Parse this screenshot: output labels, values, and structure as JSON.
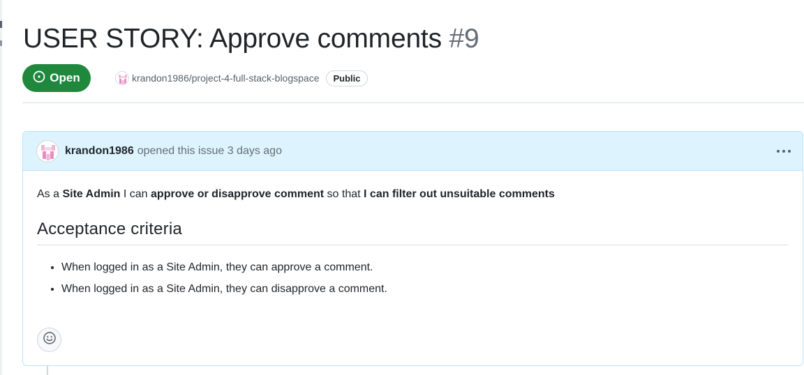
{
  "issue": {
    "title": "USER STORY: Approve comments",
    "number": "#9",
    "state": "Open",
    "repo": "krandon1986/project-4-full-stack-blogspace",
    "visibility": "Public"
  },
  "comment": {
    "author": "krandon1986",
    "meta": "opened this issue 3 days ago",
    "story": {
      "p1": "As a",
      "role": "Site Admin",
      "p2": "I can",
      "action": "approve or disapprove comment",
      "p3": "so that",
      "benefit": "I can filter out unsuitable comments"
    },
    "heading": "Acceptance criteria",
    "criteria": [
      "When logged in as a Site Admin, they can approve a comment.",
      "When logged in as a Site Admin, they can disapprove a comment."
    ]
  },
  "icons": {
    "state": "issue-opened-icon",
    "menu": "kebab-horizontal-icon",
    "reaction": "smiley-icon"
  },
  "colors": {
    "open_green": "#1f883d",
    "header_blue": "#ddf4ff",
    "border_blue": "#b6e3ff"
  }
}
